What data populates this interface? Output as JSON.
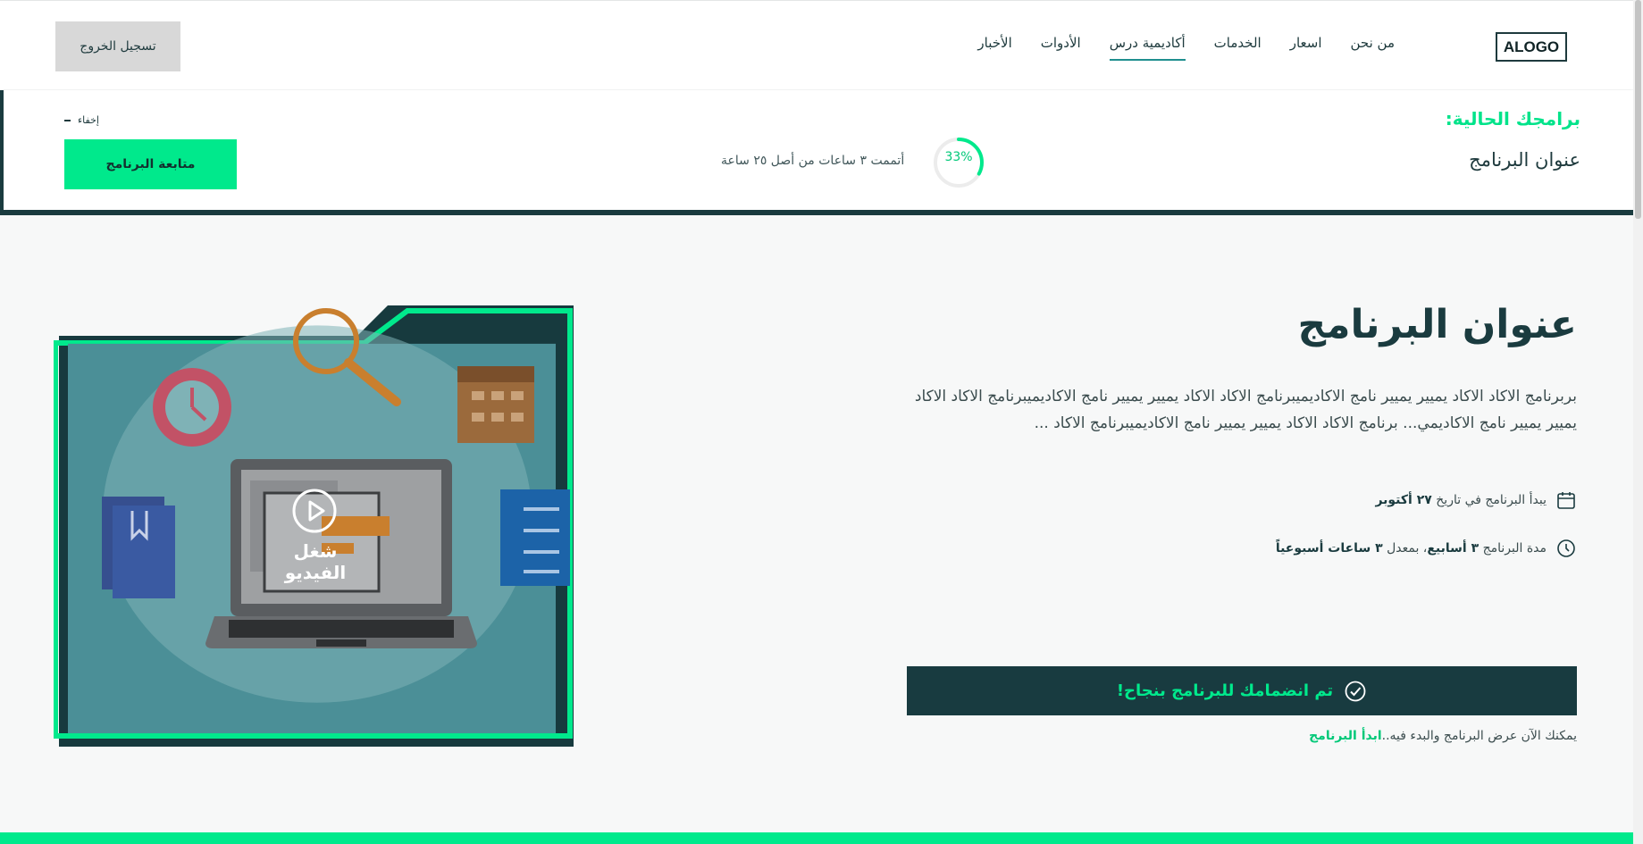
{
  "header": {
    "logo": "ALOGO",
    "nav": [
      {
        "label": "من نحن",
        "active": false
      },
      {
        "label": "اسعار",
        "active": false
      },
      {
        "label": "الخدمات",
        "active": false
      },
      {
        "label": "أكاديمية درس",
        "active": true
      },
      {
        "label": "الأدوات",
        "active": false
      },
      {
        "label": "الأخبار",
        "active": false
      }
    ],
    "logout_label": "تسجيل الخروج"
  },
  "current_programs": {
    "heading": "برامجك الحالية:",
    "program_title": "عنوان البرنامج",
    "progress_percent": 33,
    "progress_label": "33%",
    "progress_text": "أتممت ٣ ساعات من أصل ٢٥ ساعة",
    "hide_label": "إخفاء",
    "continue_label": "متابعة البرنامج"
  },
  "program": {
    "title": "عنوان البرنامج",
    "description": "بربرنامج الاكاد الاكاد يميير يميير نامج الاكاديميبرنامج الاكاد الاكاد يميير يميير نامج الاكاديميبرنامج الاكاد الاكاد يميير يميير نامج الاكاديمي... برنامج الاكاد الاكاد يميير يميير نامج الاكاديميبرنامج الاكاد ...",
    "start_date_prefix": "يبدأ البرنامج في تاريخ",
    "start_date": "٢٧ أكتوبر",
    "duration_prefix": "مدة البرنامج",
    "duration_weeks": "٣ أسابيع",
    "duration_middle": "، بمعدل",
    "duration_rate": "٣ ساعات أسبوعياً",
    "success_message": "تم انضمامك للبرنامج بنجاح!",
    "note_text": "يمكنك الآن عرض البرنامج والبدء فيه..",
    "start_link": "ابدأ البرنامج",
    "video_label": "شغل الفيديو"
  },
  "colors": {
    "accent": "#00e98c",
    "dark": "#1a3b3f",
    "video_bg": "#4b8f97"
  }
}
